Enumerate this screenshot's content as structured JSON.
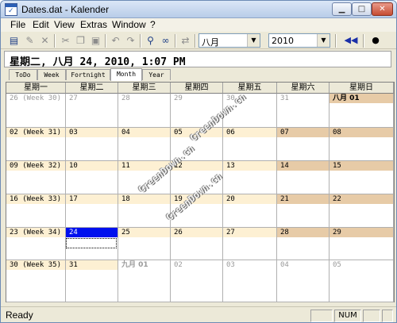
{
  "window": {
    "title": "Dates.dat - Kalender",
    "min_symbol": "▁",
    "max_symbol": "□",
    "close_symbol": "✕"
  },
  "menu": [
    "File",
    "Edit",
    "View",
    "Extras",
    "Window",
    "?"
  ],
  "toolbar": {
    "month_value": "八月",
    "year_value": "2010",
    "prev_label": "◀◀",
    "today_label": "●"
  },
  "date_display": "星期二, 八月 24, 2010, 1:07 PM",
  "tabs": [
    "ToDo",
    "Week",
    "Fortnight",
    "Month",
    "Year"
  ],
  "active_tab": "Month",
  "weekdays": [
    "星期一",
    "星期二",
    "星期三",
    "星期四",
    "星期五",
    "星期六",
    "星期日"
  ],
  "weeks": [
    [
      "26 (Week 30)",
      "27",
      "28",
      "29",
      "30",
      "31",
      "八月 01"
    ],
    [
      "02 (Week 31)",
      "03",
      "04",
      "05",
      "06",
      "07",
      "08"
    ],
    [
      "09 (Week 32)",
      "10",
      "11",
      "12",
      "13",
      "14",
      "15"
    ],
    [
      "16 (Week 33)",
      "17",
      "18",
      "19",
      "20",
      "21",
      "22"
    ],
    [
      "23 (Week 34)",
      "24",
      "25",
      "26",
      "27",
      "28",
      "29"
    ],
    [
      "30 (Week 35)",
      "31",
      "九月 01",
      "02",
      "03",
      "04",
      "05"
    ]
  ],
  "watermarks": [
    "GreenDown.cn",
    "GreenDown.cn",
    "GreenDown.cn"
  ],
  "status": {
    "text": "Ready",
    "num": "NUM"
  },
  "colors": {
    "weekday_band": "#fdf0d3",
    "weekend_band": "#e7cba7",
    "selected": "#0010ee"
  }
}
